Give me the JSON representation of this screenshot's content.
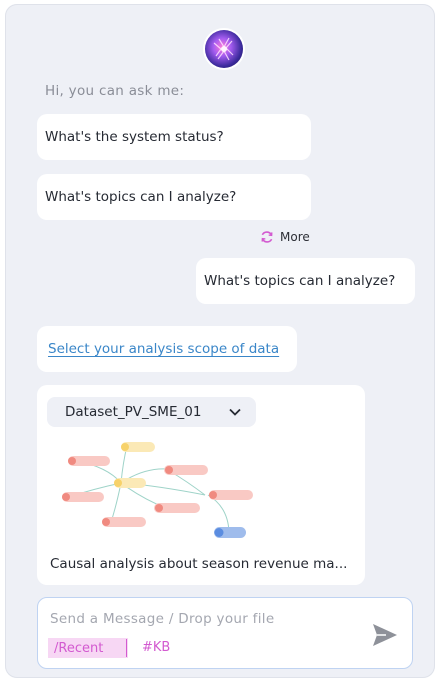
{
  "greeting": "Hi, you can ask me:",
  "suggestions": [
    {
      "text": "What's the system status?"
    },
    {
      "text": "What's topics can I analyze?"
    }
  ],
  "more_label": "More",
  "user_message": "What's topics can I analyze?",
  "scope_link": "Select your analysis scope of data",
  "dataset": {
    "selected": "Dataset_PV_SME_01",
    "caption": "Causal analysis about season revenue ma..."
  },
  "input": {
    "placeholder": "Send a Message / Drop your file",
    "tags": [
      "/Recent",
      "#KB"
    ]
  },
  "colors": {
    "panel_bg": "#eef0f6",
    "link": "#3a86c8",
    "accent_pink": "#d35ad0",
    "node_red": "#f08a80",
    "node_yellow": "#f7d26a",
    "node_blue": "#5b8de0"
  },
  "icons": [
    "assistant-avatar",
    "refresh-icon",
    "chevron-down-icon",
    "send-icon"
  ]
}
